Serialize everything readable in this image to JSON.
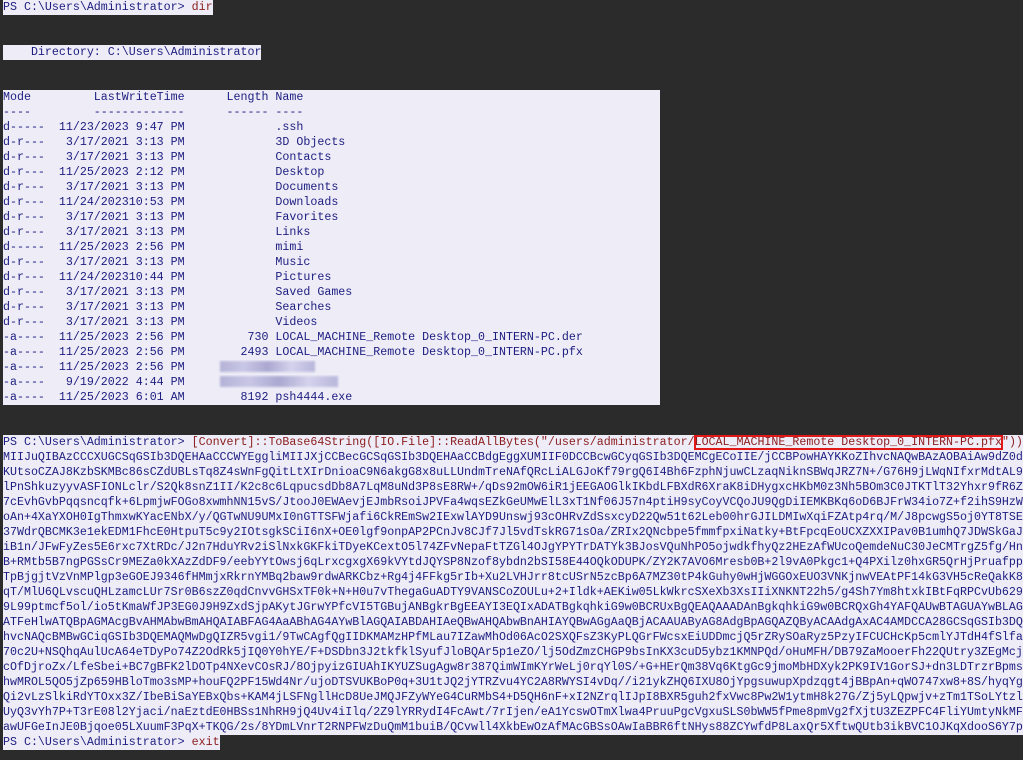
{
  "prompt": "PS C:\\Users\\Administrator> ",
  "commands": {
    "first": "dir",
    "convert_prefix": "[Convert]::ToBase64String([IO.File]::ReadAllBytes(\"/users/administrator/",
    "convert_file": "LOCAL_MACHINE_Remote Desktop_0_INTERN-PC.pfx",
    "convert_suffix": "\"))",
    "last": "exit"
  },
  "directory_label": "    Directory: C:\\Users\\Administrator",
  "listing": {
    "headers": {
      "mode": "Mode",
      "time": "LastWriteTime",
      "length": "Length",
      "name": "Name"
    },
    "underlines": {
      "mode": "----",
      "time": "-------------",
      "length": "------",
      "name": "----"
    },
    "rows": [
      {
        "mode": "d-----",
        "date": "11/23/2023",
        "time": "9:47 PM",
        "length": "",
        "name": ".ssh"
      },
      {
        "mode": "d-r---",
        "date": "3/17/2021",
        "time": "3:13 PM",
        "length": "",
        "name": "3D Objects"
      },
      {
        "mode": "d-r---",
        "date": "3/17/2021",
        "time": "3:13 PM",
        "length": "",
        "name": "Contacts"
      },
      {
        "mode": "d-r---",
        "date": "11/25/2023",
        "time": "2:12 PM",
        "length": "",
        "name": "Desktop"
      },
      {
        "mode": "d-r---",
        "date": "3/17/2021",
        "time": "3:13 PM",
        "length": "",
        "name": "Documents"
      },
      {
        "mode": "d-r---",
        "date": "11/24/2023",
        "time": "10:53 PM",
        "length": "",
        "name": "Downloads"
      },
      {
        "mode": "d-r---",
        "date": "3/17/2021",
        "time": "3:13 PM",
        "length": "",
        "name": "Favorites"
      },
      {
        "mode": "d-r---",
        "date": "3/17/2021",
        "time": "3:13 PM",
        "length": "",
        "name": "Links"
      },
      {
        "mode": "d-----",
        "date": "11/25/2023",
        "time": "2:56 PM",
        "length": "",
        "name": "mimi"
      },
      {
        "mode": "d-r---",
        "date": "3/17/2021",
        "time": "3:13 PM",
        "length": "",
        "name": "Music"
      },
      {
        "mode": "d-r---",
        "date": "11/24/2023",
        "time": "10:44 PM",
        "length": "",
        "name": "Pictures"
      },
      {
        "mode": "d-r---",
        "date": "3/17/2021",
        "time": "3:13 PM",
        "length": "",
        "name": "Saved Games"
      },
      {
        "mode": "d-r---",
        "date": "3/17/2021",
        "time": "3:13 PM",
        "length": "",
        "name": "Searches"
      },
      {
        "mode": "d-r---",
        "date": "3/17/2021",
        "time": "3:13 PM",
        "length": "",
        "name": "Videos"
      },
      {
        "mode": "-a----",
        "date": "11/25/2023",
        "time": "2:56 PM",
        "length": "730",
        "name": "LOCAL_MACHINE_Remote Desktop_0_INTERN-PC.der"
      },
      {
        "mode": "-a----",
        "date": "11/25/2023",
        "time": "2:56 PM",
        "length": "2493",
        "name": "LOCAL_MACHINE_Remote Desktop_0_INTERN-PC.pfx"
      },
      {
        "mode": "-a----",
        "date": "11/25/2023",
        "time": "2:56 PM",
        "redacted": true
      },
      {
        "mode": "-a----",
        "date": "9/19/2022",
        "time": "4:44 PM",
        "redacted": true
      },
      {
        "mode": "-a----",
        "date": "11/25/2023",
        "time": "6:01 AM",
        "length": "8192",
        "name": "psh4444.exe"
      }
    ]
  },
  "base64_output": [
    "MIIJuQIBAzCCCXUGCSqGSIb3DQEHAaCCCWYEggliMIIJXjCCBecGCSqGSIb3DQEHAaCCBdgEggXUMIIF0DCCBcwGCyqGSIb3DQEMCgECoIIE/jCCBPowHAYKKoZIhvcNAQwBAzAOBAiAw9dZ0d",
    "KUtsoCZAJ8KzbSKMBc86sCZdUBLsTq8Z4sWnFgQitLtXIrDnioaC9N6akgG8x8uLLUndmTreNAfQRcLiALGJoKf79rgQ6I4Bh6FzphNjuwCLzaqNiknSBWqJRZ7N+/G76H9jLWqNIfxrMdtAL9",
    "lPnShkuzyyvASFIONLclr/S2Qk8snZ1II/K2c8c6LqpucsdDb8A7LqM8uNd3P8sE8RW+/qDs92mOW6iR1jEEGAOGlkIKbdLFBXdR6XraK8iDHygxcHKbM0z3Nh5BOm3C0JTKTlT32Yhxr9fR6Z",
    "7cEvhGvbPqqsncqfk+6LpmjwFOGo8xwmhNN15vS/JtooJ0EWAevjEJmbRsoiJPVFa4wqsEZkGeUMwElL3xT1Nf06J57n4ptiH9syCoyVCQoJU9QgDiIEMKBKq6oD6BJFrW34io7Z+f2ihS9HzW",
    "oAn+4XaYXOH0IgThmxwKYacENbX/y/QGTwNU9UMxI0nGTTSFWjafi6CkREmSw2IExwlAYD9Unswj93cOHRvZdSsxcyD22Qw51t62Leb00hrGJILDMIwXqiFZAtp4rq/M/J8pcwgS5oj0YT8TSE",
    "37WdrQBCMK3e1ekEDM1FhcE0HtpuT5c9y2IOtsgkSCiI6nX+OE0lgf9onpAP2PCnJv8CJf7Jl5vdTskRG71sOa/ZRIx2QNcbpe5fmmfpxiNatky+BtFpcqEoUCXZXXIPav0B1umhQ7JDWSkGaJ",
    "iB1n/JFwFyZes5E6rxc7XtRDc/J2n7HduYRv2iSlNxkGKFkiTDyeKCextO5l74ZFvNepaFtTZGl4OJgYPYTrDATYk3BJosVQuNhPO5ojwdkfhyQz2HEzAfWUcoQemdeNuC30JeCMTrgZ5fg/Hn",
    "B+RMtb5B7ngPGSsCr9MEZa0kXAzZdDF9/eebYYtOwsj6qLrxcgxgX69kVYtdJQYSP8Nzof8ybdn2bSI58E44OQkODUPK/ZY2K7AVO6Mresb0B+2l9vA0Pkgc1+Q4PXilz0hxGR5QrHjPruafpp",
    "TpBjgjtVzVnMPlgp3eGOEJ9346fHMmjxRkrnYMBq2baw9rdwARKCbz+Rg4j4FFkg5rIb+Xu2LVHJrr8tcUSrN5zcBp6A7MZ30tP4kGuhy0wHjWGGOxEUO3VNKjnwVEAtPF14kG3VH5cReQakK8",
    "qT/MlU6QLvscuQHLzamcLUr7Sr0B6szZ0qdCnvvGHSxTF0k+N+H0u7vThegaGuADTY9VANSCoZOULu+2+Ildk+AEKiw05LkWkrcSXeXb3XsIIiXNKNT22h5/g4Sh7Ym8htxkIBtFqRPCvUb629",
    "9L99ptmcf5ol/io5tKmaWfJP3EG0J9H9ZxdSjpAKytJGrwYPfcVI5TGBujANBgkrBgEEAYI3EQIxADATBgkqhkiG9w0BCRUxBgQEAQAAADAnBgkqhkiG9w0BCRQxGh4YAFQAUwBTAGUAYwBLAG",
    "ATFeHlwATQBpAGMAcgBvAHMAbwBmAHQAIABFAG4AaABhAG4AYwBlAGQAIABDAHIAeQBwAHQAbwBnAHIAYQBwAGgAaQBjACAAUAByAG8AdgBpAGQAZQByACAAdgAxAC4AMDCCA28GCSqGSIb3DQ",
    "hvcNAQcBMBwGCiqGSIb3DQEMAQMwDgQIZR5vgi1/9TwCAgfQgIIDKMAMzHPfMLau7IZawMhOd06AcO2SXQFsZ3KyPLQGrFWcsxEiUDDmcjQ5rZRySOaRyz5PzyIFCUCHcKp5cmlYJTdH4fSlfa",
    "70c2U+NSQhqAulUcA64eTDyPo74Z2OdRk5jIQ0Y0hYE/F+DSDbn3J2tkfklSyufJloBQAr5p1eZO/lj5OdZmzCHGP9bsInKX3cuD5ybz1KMNPQd/oHuMFH/DB79ZaMooerFh22QUtry3ZEgMcj",
    "cOfDjroZx/LfeSbei+BC7gBFK2lDOTp4NXevCOsRJ/8OjpyizGIUAhIKYUZSugAgw8r387QimWImKYrWeLj0rqYl0S/+G+HErQm38Vq6KtgGc9jmoMbHDXyk2PK9IV1GorSJ+dn3LDTrzrBpms",
    "hwMROL5QO5jZp659HBloTmo3sMP+houFQ2PF15Wd4Nr/ujoDTSVUKBoP0q+3U1tJQ2jYTRZvu4YC2A8RWYSI4vDq//i21ykZHQ6IXU8OjYpgsuwupXpdzqgt4jBBpAn+qWO747xw8+8S/hyqYg",
    "Qi2vLzSlkiRdYTOxx3Z/IbeBiSaYEBxQbs+KAM4jLSFNgllHcD8UeJMQJFZyWYeG4CuRMbS4+D5QH6nF+xI2NZrqlIJpI8BXR5guh2fxVwc8Pw2W1ytmH8k27G/Zj5yLQpwjv+zTm1TSoLYtzl",
    "UyQ3vYh7P+T3rE08l2Yjaci/naEztdE0HBSs1NhRH9jQ4Uv4iIlq/2Z9lYRRydI4FcAwt/7rIjen/eA1YcswOTmXlwa4PruuPgcVgxuSLS0bWW5fPme8pmVg2fXjtU3ZEZPFC4FliYUmtyNkMF",
    "awUFGeInJE0Bjqoe05LXuumF3PqX+TKQG/2s/8YDmLVnrT2RNPFWzDuQmM1buiB/QCvwll4XkbEwOzAfMAcGBSsOAwIaBBR6ftNHys88ZCYwfdP8LaxQr5XftwQUtb3ikBVC1OJKqXdooS6Y7p"
  ],
  "colors": {
    "background": "#2b2b2b",
    "selection": "#eeedf7",
    "text": "#1c1c80",
    "command": "#8b1c1c",
    "highlight_box": "#e01818"
  }
}
